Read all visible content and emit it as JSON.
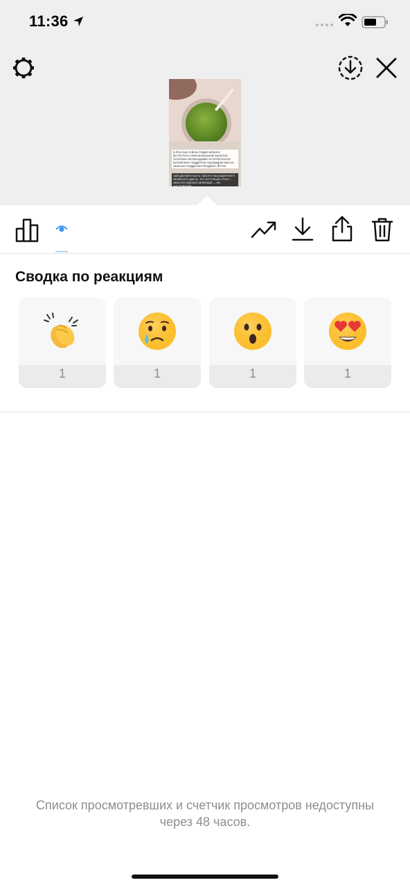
{
  "status_bar": {
    "time": "11:36"
  },
  "header": {
    "settings_icon": "gear-icon",
    "save_icon": "download-circle-icon",
    "close_icon": "close-icon"
  },
  "story_preview": {
    "caption_top": "В России очень редко можно встретить оригинальный напиток. Поэтому необходимо остерегаться китайских подделок под видом матча. Обычно подделки продают •₽ руб",
    "caption_bottom": "Чай должен быть такого насыщенного зелёного цвета, тот который стоит… неестественно зелёный — не настоящий"
  },
  "toolbar": {
    "insights_icon": "bar-chart-icon",
    "viewers_icon": "eye-icon",
    "promote_icon": "trending-up-icon",
    "download_icon": "download-icon",
    "share_icon": "share-icon",
    "delete_icon": "trash-icon"
  },
  "reactions": {
    "title": "Сводка по реакциям",
    "items": [
      {
        "emoji": "clapping-hands",
        "count": "1"
      },
      {
        "emoji": "crying-face",
        "count": "1"
      },
      {
        "emoji": "surprised-face",
        "count": "1"
      },
      {
        "emoji": "heart-eyes-face",
        "count": "1"
      }
    ]
  },
  "footer": {
    "note": "Список просмотревших и счетчик просмотров недоступны через 48 часов."
  },
  "colors": {
    "top_background": "#efefef",
    "accent_blue": "#3897f0",
    "muted_text": "#8e8e8e",
    "card_bg": "#f7f7f7"
  }
}
